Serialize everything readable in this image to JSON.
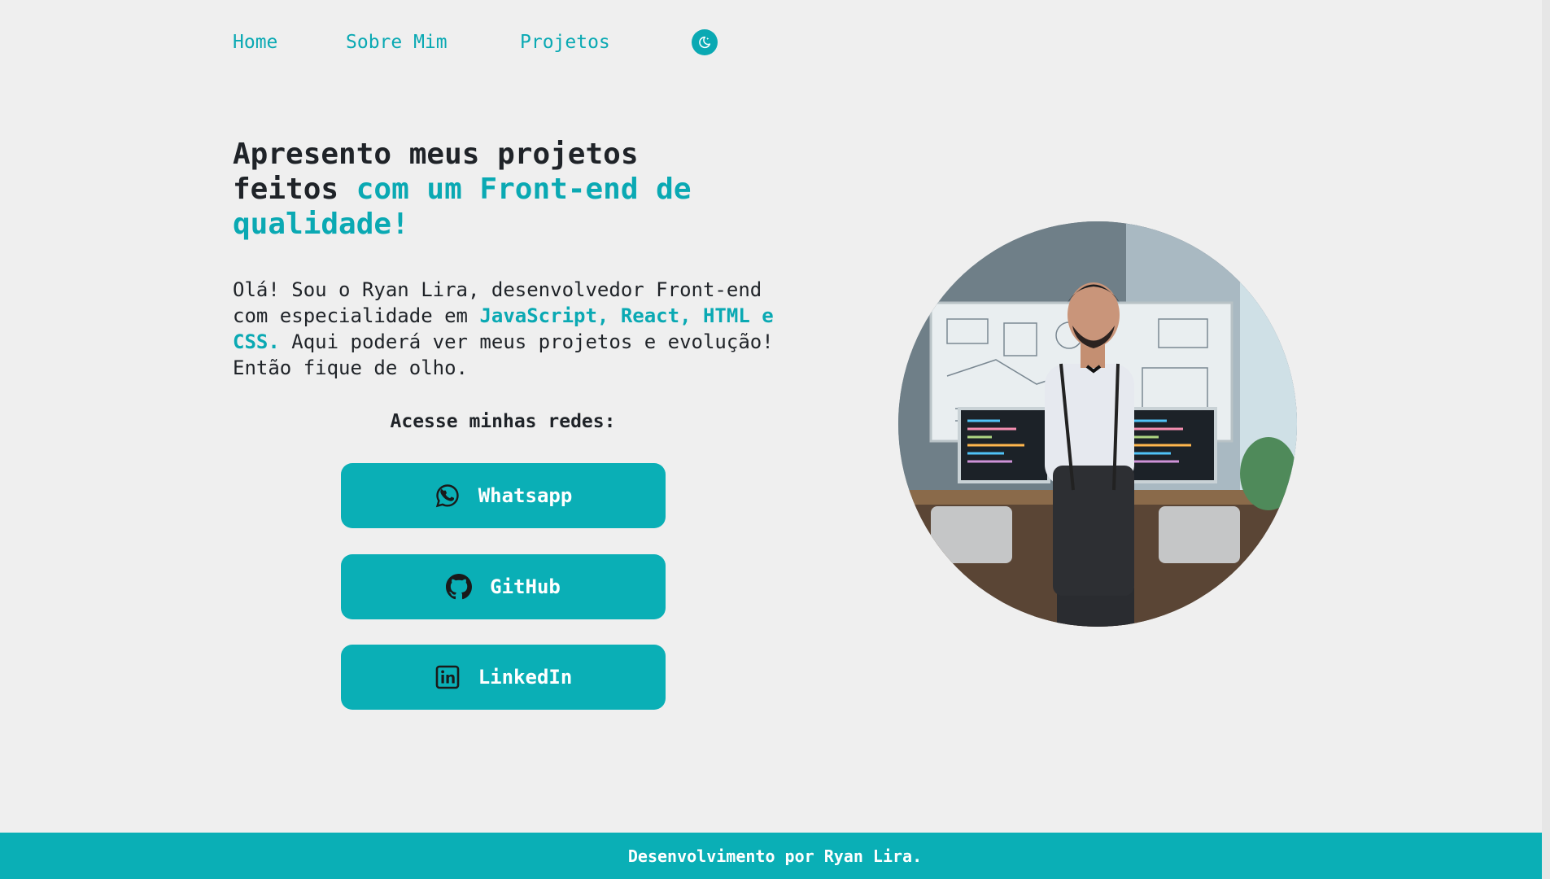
{
  "nav": {
    "home": "Home",
    "about": "Sobre Mim",
    "projects": "Projetos",
    "theme_toggle_icon": "moon-stars-icon"
  },
  "hero": {
    "title_part1": "Apresento meus projetos feitos ",
    "title_accent": "com um Front-end de qualidade!",
    "intro_part1": "Olá! Sou o Ryan Lira, desenvolvedor Front-end com especialidade em ",
    "intro_highlight": "JavaScript, React, HTML e CSS.",
    "intro_part2": " Aqui poderá ver meus projetos e evolução! Então fique de olho.",
    "networks_label": "Acesse minhas redes:",
    "buttons": [
      {
        "label": "Whatsapp",
        "icon": "whatsapp-icon"
      },
      {
        "label": "GitHub",
        "icon": "github-icon"
      },
      {
        "label": "LinkedIn",
        "icon": "linkedin-icon"
      }
    ],
    "photo_description": "profile-photo"
  },
  "footer": {
    "text": "Desenvolvimento por Ryan Lira."
  },
  "colors": {
    "accent": "#0aa9b3",
    "button_bg": "#0aafb6",
    "background": "#efefef",
    "text": "#1f2328"
  }
}
